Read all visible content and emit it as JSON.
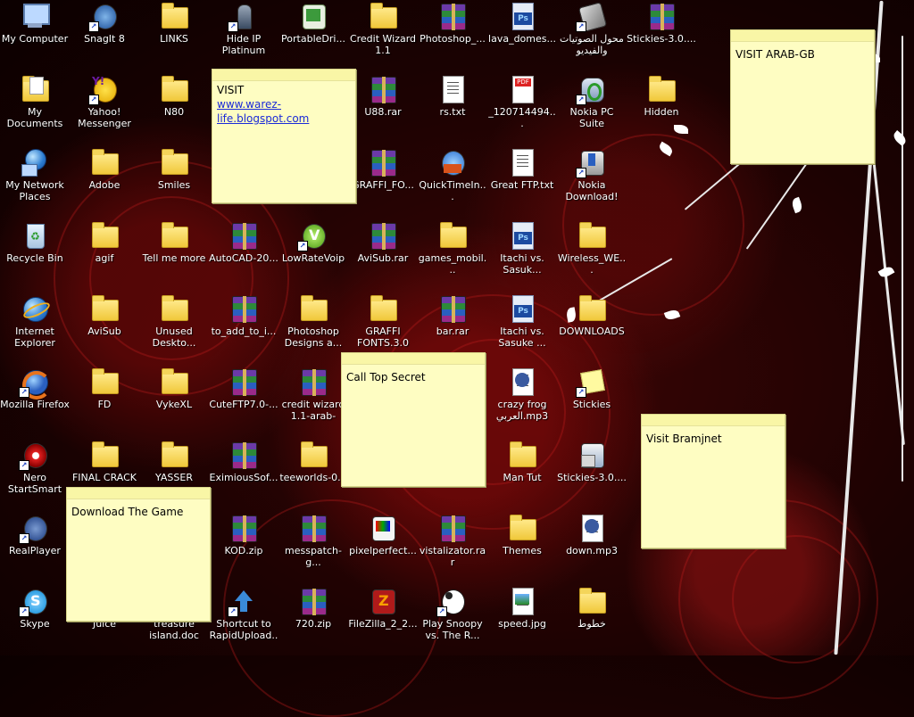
{
  "desktop": {
    "icons": [
      {
        "label": "My Computer",
        "type": "computer",
        "shortcut": false
      },
      {
        "label": "SnagIt 8",
        "type": "snagit",
        "shortcut": true
      },
      {
        "label": "LINKS",
        "type": "folder",
        "shortcut": false
      },
      {
        "label": "Hide IP Platinum",
        "type": "hideip",
        "shortcut": true
      },
      {
        "label": "PortableDri...",
        "type": "portable",
        "shortcut": false
      },
      {
        "label": "Credit Wizard 1.1",
        "type": "folder",
        "shortcut": false
      },
      {
        "label": "Photoshop_...",
        "type": "rar",
        "shortcut": false
      },
      {
        "label": "lava_domes...",
        "type": "psd",
        "shortcut": false
      },
      {
        "label": "محول الصوتيات والفيديو",
        "type": "converter",
        "shortcut": true
      },
      {
        "label": "Stickies-3.0....",
        "type": "rar",
        "shortcut": false
      },
      {
        "label": "My Documents",
        "type": "mydocs",
        "shortcut": false
      },
      {
        "label": "Yahoo! Messenger",
        "type": "yahoo",
        "shortcut": true
      },
      {
        "label": "N80",
        "type": "folder",
        "shortcut": false
      },
      {
        "label": "U88.rar",
        "type": "rar",
        "shortcut": false
      },
      {
        "label": "rs.txt",
        "type": "doc",
        "shortcut": false
      },
      {
        "label": "_120714494...",
        "type": "pdf",
        "shortcut": false
      },
      {
        "label": "Nokia PC Suite",
        "type": "nokia",
        "shortcut": true
      },
      {
        "label": "Hidden",
        "type": "folder",
        "shortcut": false
      },
      {
        "label": "My Network Places",
        "type": "network",
        "shortcut": false
      },
      {
        "label": "Adobe",
        "type": "folder",
        "shortcut": false
      },
      {
        "label": "Smiles",
        "type": "folder",
        "shortcut": false
      },
      {
        "label": "GRAFFI_FO...",
        "type": "rar",
        "shortcut": false
      },
      {
        "label": "QuickTimeIn...",
        "type": "quicktime",
        "shortcut": false
      },
      {
        "label": "Great FTP.txt",
        "type": "doc",
        "shortcut": false
      },
      {
        "label": "Nokia Download!",
        "type": "nokiadl",
        "shortcut": true
      },
      {
        "label": "Recycle Bin",
        "type": "recycle",
        "shortcut": false
      },
      {
        "label": "agif",
        "type": "folder",
        "shortcut": false
      },
      {
        "label": "Tell me more",
        "type": "folder",
        "shortcut": false
      },
      {
        "label": "AutoCAD-20...",
        "type": "rar",
        "shortcut": false
      },
      {
        "label": "LowRateVoip",
        "type": "lowrate",
        "shortcut": true
      },
      {
        "label": "AviSub.rar",
        "type": "rar",
        "shortcut": false
      },
      {
        "label": "games_mobil...",
        "type": "folder",
        "shortcut": false
      },
      {
        "label": "Itachi vs. Sasuk...",
        "type": "psd",
        "shortcut": false
      },
      {
        "label": "Wireless_WE...",
        "type": "folder",
        "shortcut": false
      },
      {
        "label": "Internet Explorer",
        "type": "ie",
        "shortcut": false
      },
      {
        "label": "AviSub",
        "type": "folder",
        "shortcut": false
      },
      {
        "label": "Unused Deskto...",
        "type": "folder",
        "shortcut": false
      },
      {
        "label": "to_add_to_i...",
        "type": "rar",
        "shortcut": false
      },
      {
        "label": "Photoshop Designs a...",
        "type": "folder",
        "shortcut": false
      },
      {
        "label": "GRAFFI FONTS.3.0",
        "type": "folder",
        "shortcut": false
      },
      {
        "label": "bar.rar",
        "type": "rar",
        "shortcut": false
      },
      {
        "label": "Itachi vs. Sasuke ...",
        "type": "psd",
        "shortcut": false
      },
      {
        "label": "DOWNLOADS",
        "type": "folder",
        "shortcut": false
      },
      {
        "label": "Mozilla Firefox",
        "type": "firefox",
        "shortcut": true
      },
      {
        "label": "FD",
        "type": "folder",
        "shortcut": false
      },
      {
        "label": "VykeXL",
        "type": "folder",
        "shortcut": false
      },
      {
        "label": "CuteFTP7.0-...",
        "type": "rar",
        "shortcut": false
      },
      {
        "label": "credit wizard 1.1-arab-gb-...",
        "type": "rar",
        "shortcut": false
      },
      {
        "label": "crazy frog العربي.mp3",
        "type": "realaudio",
        "shortcut": false
      },
      {
        "label": "Stickies",
        "type": "stickies",
        "shortcut": true
      },
      {
        "label": "Nero StartSmart",
        "type": "nero",
        "shortcut": true
      },
      {
        "label": "FINAL CRACK",
        "type": "folder",
        "shortcut": false
      },
      {
        "label": "YASSER",
        "type": "folder",
        "shortcut": false
      },
      {
        "label": "EximiousSof...",
        "type": "rar",
        "shortcut": false
      },
      {
        "label": "teeworlds-0...",
        "type": "folder",
        "shortcut": false
      },
      {
        "label": "Man Tut",
        "type": "folder",
        "shortcut": false
      },
      {
        "label": "Stickies-3.0....",
        "type": "installer",
        "shortcut": false
      },
      {
        "label": "RealPlayer",
        "type": "realplayer",
        "shortcut": true
      },
      {
        "label": "KOD.zip",
        "type": "rar",
        "shortcut": false
      },
      {
        "label": "messpatch-g...",
        "type": "rar",
        "shortcut": false
      },
      {
        "label": "pixelperfect...",
        "type": "pixel",
        "shortcut": false
      },
      {
        "label": "vistalizator.rar",
        "type": "rar",
        "shortcut": false
      },
      {
        "label": "Themes",
        "type": "folder",
        "shortcut": false
      },
      {
        "label": "down.mp3",
        "type": "realaudio",
        "shortcut": false
      },
      {
        "label": "Skype",
        "type": "skype",
        "shortcut": true
      },
      {
        "label": "Juice",
        "type": "none",
        "shortcut": false
      },
      {
        "label": "treasure island.doc",
        "type": "none",
        "shortcut": false
      },
      {
        "label": "Shortcut to RapidUpload....",
        "type": "upload",
        "shortcut": true
      },
      {
        "label": "720.zip",
        "type": "rar",
        "shortcut": false
      },
      {
        "label": "FileZilla_2_2...",
        "type": "filezilla",
        "shortcut": false
      },
      {
        "label": "Play Snoopy vs. The R...",
        "type": "snoopy",
        "shortcut": true
      },
      {
        "label": "speed.jpg",
        "type": "jpg",
        "shortcut": false
      },
      {
        "label": "خطوط",
        "type": "folder",
        "shortcut": false
      }
    ],
    "notes": [
      {
        "line1": "VISIT",
        "link": "www.warez-life.blogspot.com"
      },
      {
        "text": "VISIT ARAB-GB"
      },
      {
        "text": "Call Top Secret"
      },
      {
        "text": "Visit Bramjnet"
      },
      {
        "text": "Download The Game"
      }
    ]
  }
}
